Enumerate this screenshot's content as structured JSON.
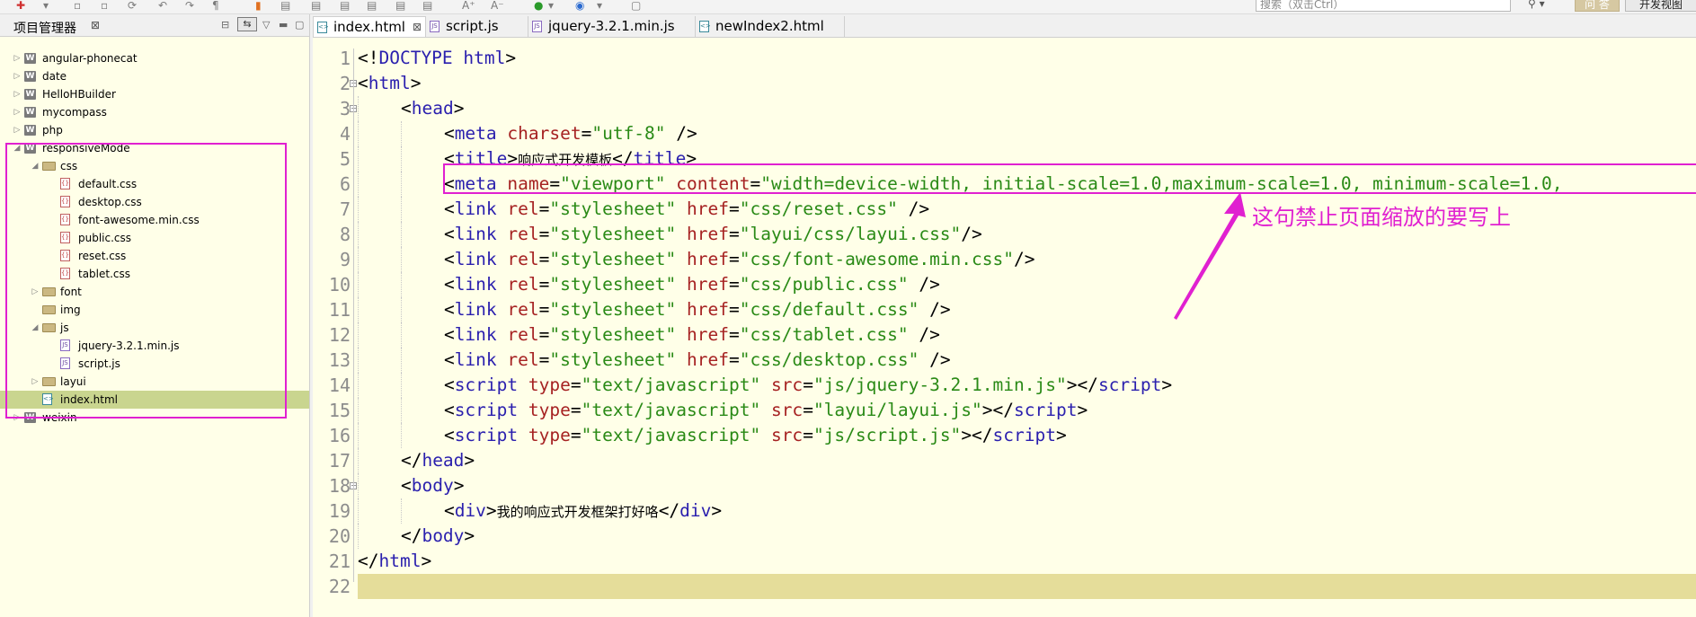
{
  "toolbar": {
    "search_placeholder": "搜索（双击Ctrl）",
    "search_icon": "search-icon",
    "ask_label": "问 答",
    "view_label": "开发视图"
  },
  "project_panel": {
    "title": "项目管理器",
    "close": "⊠",
    "tree": [
      {
        "label": "angular-phonecat",
        "type": "project",
        "level": 0,
        "expanded": false
      },
      {
        "label": "date",
        "type": "project",
        "level": 0,
        "expanded": false
      },
      {
        "label": "HelloHBuilder",
        "type": "project",
        "level": 0,
        "expanded": false
      },
      {
        "label": "mycompass",
        "type": "project",
        "level": 0,
        "expanded": false
      },
      {
        "label": "php",
        "type": "project",
        "level": 0,
        "expanded": false
      },
      {
        "label": "responsiveMode",
        "type": "project",
        "level": 0,
        "expanded": true
      },
      {
        "label": "css",
        "type": "folder",
        "level": 1,
        "expanded": true
      },
      {
        "label": "default.css",
        "type": "css",
        "level": 2
      },
      {
        "label": "desktop.css",
        "type": "css",
        "level": 2
      },
      {
        "label": "font-awesome.min.css",
        "type": "css",
        "level": 2
      },
      {
        "label": "public.css",
        "type": "css",
        "level": 2
      },
      {
        "label": "reset.css",
        "type": "css",
        "level": 2
      },
      {
        "label": "tablet.css",
        "type": "css",
        "level": 2
      },
      {
        "label": "font",
        "type": "folder",
        "level": 1,
        "expanded": false
      },
      {
        "label": "img",
        "type": "folder",
        "level": 1,
        "expanded": null
      },
      {
        "label": "js",
        "type": "folder",
        "level": 1,
        "expanded": true
      },
      {
        "label": "jquery-3.2.1.min.js",
        "type": "js",
        "level": 2
      },
      {
        "label": "script.js",
        "type": "js",
        "level": 2
      },
      {
        "label": "layui",
        "type": "folder",
        "level": 1,
        "expanded": false
      },
      {
        "label": "index.html",
        "type": "html",
        "level": 1,
        "selected": true
      },
      {
        "label": "weixin",
        "type": "project",
        "level": 0,
        "expanded": false
      }
    ]
  },
  "editor": {
    "tabs": [
      {
        "label": "index.html",
        "active": true,
        "close": "⊠",
        "icon": "html"
      },
      {
        "label": "script.js",
        "active": false,
        "icon": "js"
      },
      {
        "label": "jquery-3.2.1.min.js",
        "active": false,
        "icon": "js"
      },
      {
        "label": "newIndex2.html",
        "active": false,
        "icon": "html"
      }
    ],
    "lines": [
      {
        "n": "1",
        "indent": 0,
        "tokens": [
          [
            "punc",
            "<!"
          ],
          [
            "tag",
            "DOCTYPE html"
          ],
          [
            "punc",
            ">"
          ]
        ]
      },
      {
        "n": "2",
        "indent": 0,
        "fold": true,
        "tokens": [
          [
            "punc",
            "<"
          ],
          [
            "tag",
            "html"
          ],
          [
            "punc",
            ">"
          ]
        ]
      },
      {
        "n": "3",
        "indent": 1,
        "fold": true,
        "tokens": [
          [
            "punc",
            "<"
          ],
          [
            "tag",
            "head"
          ],
          [
            "punc",
            ">"
          ]
        ]
      },
      {
        "n": "4",
        "indent": 2,
        "tokens": [
          [
            "punc",
            "<"
          ],
          [
            "tag",
            "meta"
          ],
          [
            "punc",
            " "
          ],
          [
            "attr",
            "charset"
          ],
          [
            "punc",
            "="
          ],
          [
            "val",
            "\"utf-8\""
          ],
          [
            "punc",
            " />"
          ]
        ]
      },
      {
        "n": "5",
        "indent": 2,
        "tokens": [
          [
            "punc",
            "<"
          ],
          [
            "tag",
            "title"
          ],
          [
            "punc",
            ">"
          ],
          [
            "txt",
            "响应式开发模板"
          ],
          [
            "punc",
            "</"
          ],
          [
            "tag",
            "title"
          ],
          [
            "punc",
            ">"
          ]
        ]
      },
      {
        "n": "6",
        "indent": 2,
        "tokens": [
          [
            "punc",
            "<"
          ],
          [
            "tag",
            "meta"
          ],
          [
            "punc",
            " "
          ],
          [
            "attr",
            "name"
          ],
          [
            "punc",
            "="
          ],
          [
            "val",
            "\"viewport\""
          ],
          [
            "punc",
            " "
          ],
          [
            "attr",
            "content"
          ],
          [
            "punc",
            "="
          ],
          [
            "val",
            "\"width=device-width, initial-scale=1.0,maximum-scale=1.0, minimum-scale=1.0,"
          ]
        ]
      },
      {
        "n": "7",
        "indent": 2,
        "tokens": [
          [
            "punc",
            "<"
          ],
          [
            "tag",
            "link"
          ],
          [
            "punc",
            " "
          ],
          [
            "attr",
            "rel"
          ],
          [
            "punc",
            "="
          ],
          [
            "val",
            "\"stylesheet\""
          ],
          [
            "punc",
            " "
          ],
          [
            "attr",
            "href"
          ],
          [
            "punc",
            "="
          ],
          [
            "val",
            "\"css/reset.css\""
          ],
          [
            "punc",
            " />"
          ]
        ]
      },
      {
        "n": "8",
        "indent": 2,
        "tokens": [
          [
            "punc",
            "<"
          ],
          [
            "tag",
            "link"
          ],
          [
            "punc",
            " "
          ],
          [
            "attr",
            "rel"
          ],
          [
            "punc",
            "="
          ],
          [
            "val",
            "\"stylesheet\""
          ],
          [
            "punc",
            " "
          ],
          [
            "attr",
            "href"
          ],
          [
            "punc",
            "="
          ],
          [
            "val",
            "\"layui/css/layui.css\""
          ],
          [
            "punc",
            "/>"
          ]
        ]
      },
      {
        "n": "9",
        "indent": 2,
        "tokens": [
          [
            "punc",
            "<"
          ],
          [
            "tag",
            "link"
          ],
          [
            "punc",
            " "
          ],
          [
            "attr",
            "rel"
          ],
          [
            "punc",
            "="
          ],
          [
            "val",
            "\"stylesheet\""
          ],
          [
            "punc",
            " "
          ],
          [
            "attr",
            "href"
          ],
          [
            "punc",
            "="
          ],
          [
            "val",
            "\"css/font-awesome.min.css\""
          ],
          [
            "punc",
            "/>"
          ]
        ]
      },
      {
        "n": "10",
        "indent": 2,
        "tokens": [
          [
            "punc",
            "<"
          ],
          [
            "tag",
            "link"
          ],
          [
            "punc",
            " "
          ],
          [
            "attr",
            "rel"
          ],
          [
            "punc",
            "="
          ],
          [
            "val",
            "\"stylesheet\""
          ],
          [
            "punc",
            " "
          ],
          [
            "attr",
            "href"
          ],
          [
            "punc",
            "="
          ],
          [
            "val",
            "\"css/public.css\""
          ],
          [
            "punc",
            " />"
          ]
        ]
      },
      {
        "n": "11",
        "indent": 2,
        "tokens": [
          [
            "punc",
            "<"
          ],
          [
            "tag",
            "link"
          ],
          [
            "punc",
            " "
          ],
          [
            "attr",
            "rel"
          ],
          [
            "punc",
            "="
          ],
          [
            "val",
            "\"stylesheet\""
          ],
          [
            "punc",
            " "
          ],
          [
            "attr",
            "href"
          ],
          [
            "punc",
            "="
          ],
          [
            "val",
            "\"css/default.css\""
          ],
          [
            "punc",
            " />"
          ]
        ]
      },
      {
        "n": "12",
        "indent": 2,
        "tokens": [
          [
            "punc",
            "<"
          ],
          [
            "tag",
            "link"
          ],
          [
            "punc",
            " "
          ],
          [
            "attr",
            "rel"
          ],
          [
            "punc",
            "="
          ],
          [
            "val",
            "\"stylesheet\""
          ],
          [
            "punc",
            " "
          ],
          [
            "attr",
            "href"
          ],
          [
            "punc",
            "="
          ],
          [
            "val",
            "\"css/tablet.css\""
          ],
          [
            "punc",
            " />"
          ]
        ]
      },
      {
        "n": "13",
        "indent": 2,
        "tokens": [
          [
            "punc",
            "<"
          ],
          [
            "tag",
            "link"
          ],
          [
            "punc",
            " "
          ],
          [
            "attr",
            "rel"
          ],
          [
            "punc",
            "="
          ],
          [
            "val",
            "\"stylesheet\""
          ],
          [
            "punc",
            " "
          ],
          [
            "attr",
            "href"
          ],
          [
            "punc",
            "="
          ],
          [
            "val",
            "\"css/desktop.css\""
          ],
          [
            "punc",
            " />"
          ]
        ]
      },
      {
        "n": "14",
        "indent": 2,
        "tokens": [
          [
            "punc",
            "<"
          ],
          [
            "tag",
            "script"
          ],
          [
            "punc",
            " "
          ],
          [
            "attr",
            "type"
          ],
          [
            "punc",
            "="
          ],
          [
            "val",
            "\"text/javascript\""
          ],
          [
            "punc",
            " "
          ],
          [
            "attr",
            "src"
          ],
          [
            "punc",
            "="
          ],
          [
            "val",
            "\"js/jquery-3.2.1.min.js\""
          ],
          [
            "punc",
            "></"
          ],
          [
            "tag",
            "script"
          ],
          [
            "punc",
            ">"
          ]
        ]
      },
      {
        "n": "15",
        "indent": 2,
        "tokens": [
          [
            "punc",
            "<"
          ],
          [
            "tag",
            "script"
          ],
          [
            "punc",
            " "
          ],
          [
            "attr",
            "type"
          ],
          [
            "punc",
            "="
          ],
          [
            "val",
            "\"text/javascript\""
          ],
          [
            "punc",
            " "
          ],
          [
            "attr",
            "src"
          ],
          [
            "punc",
            "="
          ],
          [
            "val",
            "\"layui/layui.js\""
          ],
          [
            "punc",
            "></"
          ],
          [
            "tag",
            "script"
          ],
          [
            "punc",
            ">"
          ]
        ]
      },
      {
        "n": "16",
        "indent": 2,
        "tokens": [
          [
            "punc",
            "<"
          ],
          [
            "tag",
            "script"
          ],
          [
            "punc",
            " "
          ],
          [
            "attr",
            "type"
          ],
          [
            "punc",
            "="
          ],
          [
            "val",
            "\"text/javascript\""
          ],
          [
            "punc",
            " "
          ],
          [
            "attr",
            "src"
          ],
          [
            "punc",
            "="
          ],
          [
            "val",
            "\"js/script.js\""
          ],
          [
            "punc",
            "></"
          ],
          [
            "tag",
            "script"
          ],
          [
            "punc",
            ">"
          ]
        ]
      },
      {
        "n": "17",
        "indent": 1,
        "tokens": [
          [
            "punc",
            "</"
          ],
          [
            "tag",
            "head"
          ],
          [
            "punc",
            ">"
          ]
        ]
      },
      {
        "n": "18",
        "indent": 1,
        "fold": true,
        "tokens": [
          [
            "punc",
            "<"
          ],
          [
            "tag",
            "body"
          ],
          [
            "punc",
            ">"
          ]
        ]
      },
      {
        "n": "19",
        "indent": 2,
        "tokens": [
          [
            "punc",
            "<"
          ],
          [
            "tag",
            "div"
          ],
          [
            "punc",
            ">"
          ],
          [
            "txt",
            "我的响应式开发框架打好咯"
          ],
          [
            "punc",
            "</"
          ],
          [
            "tag",
            "div"
          ],
          [
            "punc",
            ">"
          ]
        ]
      },
      {
        "n": "20",
        "indent": 1,
        "tokens": [
          [
            "punc",
            "</"
          ],
          [
            "tag",
            "body"
          ],
          [
            "punc",
            ">"
          ]
        ]
      },
      {
        "n": "21",
        "indent": 0,
        "tokens": [
          [
            "punc",
            "</"
          ],
          [
            "tag",
            "html"
          ],
          [
            "punc",
            ">"
          ]
        ]
      },
      {
        "n": "22",
        "indent": 0,
        "current": true,
        "tokens": []
      }
    ]
  },
  "annotation": {
    "text": "这句禁止页面缩放的要写上",
    "color": "#e020d0"
  }
}
